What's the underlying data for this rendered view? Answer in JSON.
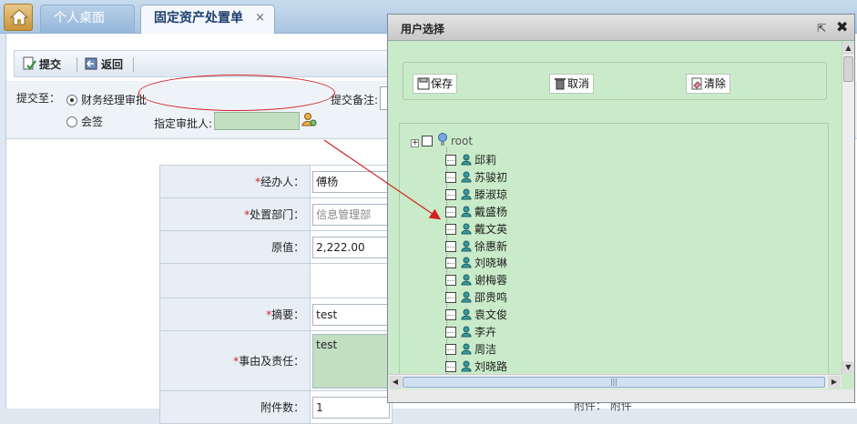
{
  "tabs": {
    "home_icon": "home-icon",
    "desktop_label": "个人桌面",
    "form_label": "固定资产处置单",
    "close_glyph": "×"
  },
  "toolbar": {
    "submit_label": "提交",
    "back_label": "返回"
  },
  "submit_area": {
    "submit_to_label": "提交至：",
    "option_finance": "财务经理审批",
    "option_countersign": "会签",
    "selected_option": "财务经理审批",
    "note_label": "提交备注:",
    "approver_label": "指定审批人:",
    "approver_value": ""
  },
  "form": {
    "handler_label": "经办人：",
    "handler_value": "傅杨",
    "department_label": "处置部门：",
    "department_value": "信息管理部",
    "original_value_label": "原值：",
    "original_value": "2,222.00",
    "summary_label": "摘要：",
    "summary_value": "test",
    "reason_label": "事由及责任：",
    "reason_value": "test",
    "attachments_label": "附件数：",
    "attachments_value": "1",
    "required_mark": "*"
  },
  "bottom_strip_text": "附件：    附件",
  "dialog": {
    "title": "用户选择",
    "popout_glyph": "⇱",
    "close_glyph": "✖",
    "save_label": "保存",
    "cancel_label": "取消",
    "clear_label": "清除",
    "tree": {
      "root_label": "root",
      "users": [
        "邱莉",
        "苏骏初",
        "滕淑琼",
        "戴盛杨",
        "戴文英",
        "徐惠新",
        "刘晓琳",
        "谢梅蓉",
        "邵贵鸣",
        "袁文俊",
        "李卉",
        "周洁",
        "刘晓路"
      ]
    }
  },
  "colors": {
    "dialog_bg": "#c9ebc9",
    "annotation_red": "#d42020",
    "input_green": "#c2dfc2"
  }
}
